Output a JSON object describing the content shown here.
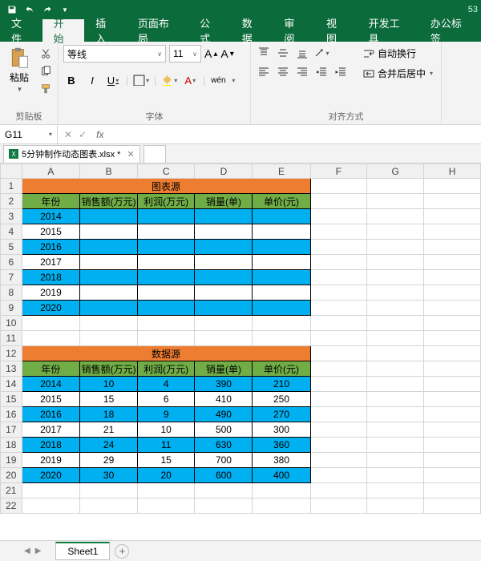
{
  "titlebar": {
    "right_text": "53"
  },
  "menu": {
    "file": "文件",
    "home": "开始",
    "insert": "插入",
    "layout": "页面布局",
    "formula": "公式",
    "data": "数据",
    "review": "审阅",
    "view": "视图",
    "dev": "开发工具",
    "office": "办公标签"
  },
  "ribbon": {
    "clipboard": {
      "paste": "粘贴",
      "group": "剪贴板"
    },
    "font": {
      "name": "等线",
      "size": "11",
      "group": "字体",
      "wen": "wén"
    },
    "align": {
      "wrap": "自动换行",
      "merge": "合并后居中",
      "group": "对齐方式"
    }
  },
  "namebox": "G11",
  "filetab": "5分钟制作动态图表.xlsx *",
  "columns": [
    "A",
    "B",
    "C",
    "D",
    "E",
    "F",
    "G",
    "H"
  ],
  "rows": [
    1,
    2,
    3,
    4,
    5,
    6,
    7,
    8,
    9,
    10,
    11,
    12,
    13,
    14,
    15,
    16,
    17,
    18,
    19,
    20,
    21,
    22
  ],
  "chart_source": {
    "title": "图表源",
    "headers": [
      "年份",
      "销售额(万元)",
      "利润(万元)",
      "销量(单)",
      "单价(元)"
    ],
    "years": [
      "2014",
      "2015",
      "2016",
      "2017",
      "2018",
      "2019",
      "2020"
    ]
  },
  "chart_data": {
    "type": "table",
    "title": "数据源",
    "headers": [
      "年份",
      "销售额(万元)",
      "利润(万元)",
      "销量(单)",
      "单价(元)"
    ],
    "rows": [
      {
        "year": "2014",
        "sales": 10,
        "profit": 4,
        "volume": 390,
        "price": 210
      },
      {
        "year": "2015",
        "sales": 15,
        "profit": 6,
        "volume": 410,
        "price": 250
      },
      {
        "year": "2016",
        "sales": 18,
        "profit": 9,
        "volume": 490,
        "price": 270
      },
      {
        "year": "2017",
        "sales": 21,
        "profit": 10,
        "volume": 500,
        "price": 300
      },
      {
        "year": "2018",
        "sales": 24,
        "profit": 11,
        "volume": 630,
        "price": 360
      },
      {
        "year": "2019",
        "sales": 29,
        "profit": 15,
        "volume": 700,
        "price": 380
      },
      {
        "year": "2020",
        "sales": 30,
        "profit": 20,
        "volume": 600,
        "price": 400
      }
    ]
  },
  "sheettab": "Sheet1"
}
